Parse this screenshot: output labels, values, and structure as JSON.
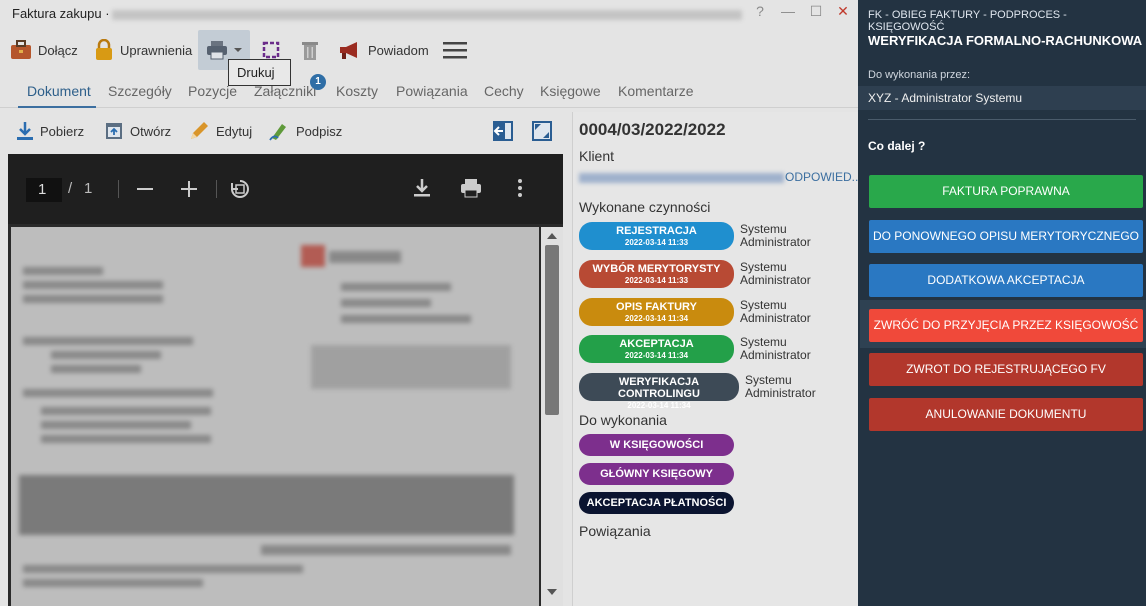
{
  "window": {
    "title": "Faktura zakupu ·",
    "controls": [
      "?",
      "—",
      "☐",
      "✕"
    ]
  },
  "toolbar": {
    "attach_label": "Dołącz",
    "permissions_label": "Uprawnienia",
    "notify_label": "Powiadom",
    "print_tooltip": "Drukuj"
  },
  "tabs": [
    {
      "label": "Dokument"
    },
    {
      "label": "Szczegóły"
    },
    {
      "label": "Pozycje"
    },
    {
      "label": "Załączniki"
    },
    {
      "label": "Koszty"
    },
    {
      "label": "Powiązania"
    },
    {
      "label": "Cechy"
    },
    {
      "label": "Księgowe"
    },
    {
      "label": "Komentarze"
    }
  ],
  "attachments_badge": "1",
  "doc_tools": {
    "download_label": "Pobierz",
    "open_label": "Otwórz",
    "edit_label": "Edytuj",
    "sign_label": "Podpisz"
  },
  "pdf": {
    "current_page": "1",
    "separator": "/",
    "total_pages": "1"
  },
  "document": {
    "number": "0004/03/2022/2022",
    "client_heading": "Klient",
    "client_suffix": "ODPOWIED...",
    "done_heading": "Wykonane czynności",
    "todo_heading": "Do wykonania",
    "links_heading": "Powiązania",
    "done_steps": [
      {
        "label": "REJESTRACJA",
        "date": "2022-03-14 11:33",
        "who1": "Systemu",
        "who2": "Administrator",
        "color": "#1f8fcf"
      },
      {
        "label": "WYBÓR MERYTORYSTY",
        "date": "2022-03-14 11:33",
        "who1": "Systemu",
        "who2": "Administrator",
        "color": "#b84a34"
      },
      {
        "label": "OPIS FAKTURY",
        "date": "2022-03-14 11:34",
        "who1": "Systemu",
        "who2": "Administrator",
        "color": "#c98b0e"
      },
      {
        "label": "AKCEPTACJA",
        "date": "2022-03-14 11:34",
        "who1": "Systemu",
        "who2": "Administrator",
        "color": "#23a049"
      },
      {
        "label": "WERYFIKACJA CONTROLINGU",
        "date": "2022-03-14 11:34",
        "who1": "Systemu",
        "who2": "Administrator",
        "color": "#3d4a56"
      }
    ],
    "todo_steps": [
      {
        "label": "W KSIĘGOWOŚCI",
        "color": "#7d2f8d"
      },
      {
        "label": "GŁÓWNY KSIĘGOWY",
        "color": "#7d2f8d"
      },
      {
        "label": "AKCEPTACJA PŁATNOŚCI",
        "color": "#0b1430"
      }
    ]
  },
  "workflow": {
    "subtitle": "FK - OBIEG FAKTURY - PODPROCES - KSIĘGOWOŚĆ",
    "title": "WERYFIKACJA FORMALNO-RACHUNKOWA",
    "executor_label": "Do wykonania przez:",
    "executor_value": "XYZ - Administrator Systemu",
    "next_label": "Co dalej ?",
    "actions": [
      {
        "label": "FAKTURA POPRAWNA",
        "color": "#29a84b"
      },
      {
        "label": "DO PONOWNEGO OPISU MERYTORYCZNEGO",
        "color": "#2a78c2"
      },
      {
        "label": "DODATKOWA AKCEPTACJA",
        "color": "#2a78c2"
      },
      {
        "label": "ZWRÓĆ DO PRZYJĘCIA PRZEZ KSIĘGOWOŚĆ",
        "color": "#f0493a"
      },
      {
        "label": "ZWROT DO REJESTRUJĄCEGO FV",
        "color": "#b2372c"
      },
      {
        "label": "ANULOWANIE DOKUMENTU",
        "color": "#b2372c"
      }
    ]
  }
}
